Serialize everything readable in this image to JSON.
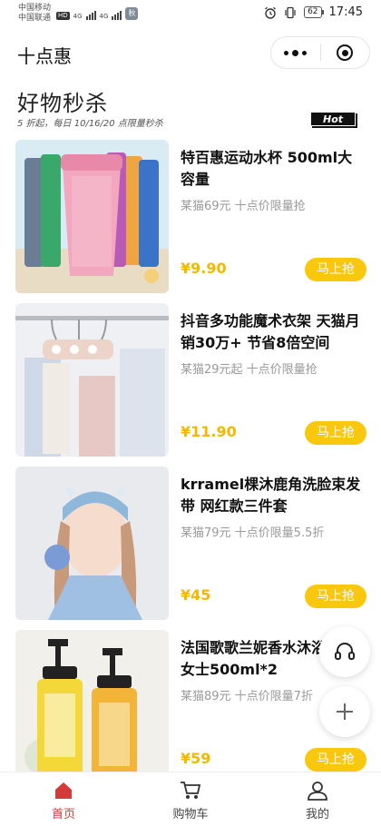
{
  "status_bar": {
    "carrier_1": "中国移动",
    "carrier_2": "中国联通",
    "net_1": "4G",
    "net_2": "4G",
    "hd": "HD",
    "app_badge": "秋",
    "battery": "62",
    "time": "17:45",
    "icons": [
      "alarm-icon",
      "vibrate-icon",
      "battery-icon",
      "signal-icon"
    ]
  },
  "nav": {
    "title": "十点惠",
    "capsule_icons": [
      "more-icon",
      "close-target-icon"
    ]
  },
  "header": {
    "heading": "好物秒杀",
    "subtitle": "5 折起，每日 10/16/20 点限量秒杀",
    "hot_tag": "Hot"
  },
  "products": [
    {
      "name": "特百惠运动水杯 500ml大容量",
      "orig": "某猫69元 十点价限量抢",
      "price": "¥9.90",
      "buy": "马上抢",
      "image": "water-bottle-image"
    },
    {
      "name": "抖音多功能魔术衣架 天猫月销30万+ 节省8倍空间",
      "orig": "某猫29元起 十点价限量抢",
      "price": "¥11.90",
      "buy": "马上抢",
      "image": "clothes-hanger-image"
    },
    {
      "name": "krramel棵沐鹿角洗脸束发带 网红款三件套",
      "orig": "某猫79元 十点价限量5.5折",
      "price": "¥45",
      "buy": "马上抢",
      "image": "headband-image"
    },
    {
      "name": "法国歌歌兰妮香水沐浴露男女士500ml*2",
      "orig": "某猫89元 十点价限量7折",
      "price": "¥59",
      "buy": "马上抢",
      "image": "shower-gel-image"
    }
  ],
  "fabs": [
    "customer-service-icon",
    "add-icon"
  ],
  "tabs": [
    {
      "label": "首页",
      "icon": "home-icon",
      "active": true
    },
    {
      "label": "购物车",
      "icon": "cart-icon",
      "active": false
    },
    {
      "label": "我的",
      "icon": "profile-icon",
      "active": false
    }
  ],
  "colors": {
    "accent_yellow": "#f9c80e",
    "price_yellow": "#f5b800",
    "active_tab_red": "#d43a3a"
  }
}
